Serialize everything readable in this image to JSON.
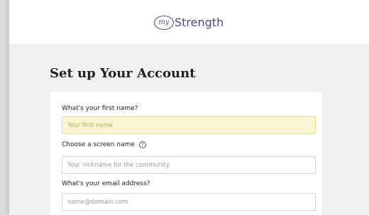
{
  "header": {
    "logo_mark": "my",
    "logo_word": "Strength"
  },
  "page": {
    "title": "Set up Your Account"
  },
  "form": {
    "first_name": {
      "label": "What's your first name?",
      "placeholder": "Your first name",
      "focused": true
    },
    "screen_name": {
      "label": "Choose a screen name",
      "placeholder": "Your nickname for the community",
      "help_icon": "question-mark-icon",
      "help_glyph": "?"
    },
    "email": {
      "label": "What's your email address?",
      "placeholder": "name@domain.com"
    }
  },
  "colors": {
    "brand": "#4e4a8a",
    "focused_field_background": "#fbf6d2",
    "page_background": "#f1f1f1"
  }
}
